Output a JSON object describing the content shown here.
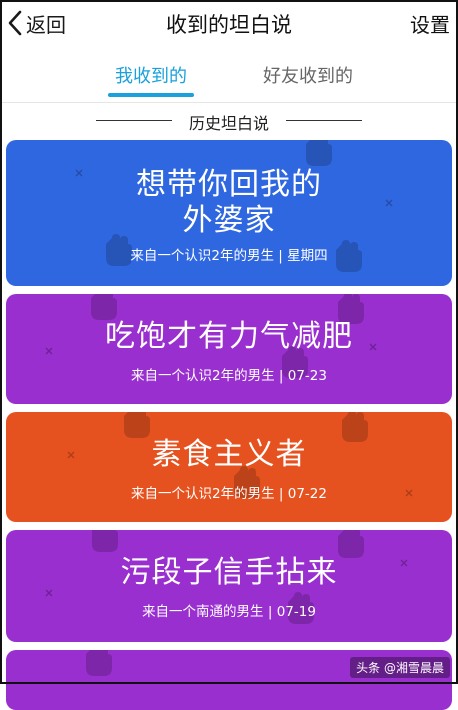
{
  "navbar": {
    "back_label": "返回",
    "title": "收到的坦白说",
    "settings_label": "设置"
  },
  "tabs": [
    {
      "label": "我收到的",
      "active": true
    },
    {
      "label": "好友收到的",
      "active": false
    }
  ],
  "section_title": "历史坦白说",
  "cards": [
    {
      "title_line1": "想带你回我的",
      "title_line2": "外婆家",
      "subtitle": "来自一个认识2年的男生 | 星期四",
      "color": "#2f67e0"
    },
    {
      "title_line1": "吃饱才有力气减肥",
      "subtitle": "来自一个认识2年的男生 | 07-23",
      "color": "#9a2fcf"
    },
    {
      "title_line1": "素食主义者",
      "subtitle": "来自一个认识2年的男生 | 07-22",
      "color": "#e6521f"
    },
    {
      "title_line1": "污段子信手拈来",
      "subtitle": "来自一个南通的男生 | 07-19",
      "color": "#9a2fcf"
    },
    {
      "title_line1": "",
      "subtitle": "",
      "color": "#9a2fcf"
    }
  ],
  "watermark": "头条 @湘雪晨晨",
  "colors": {
    "accent": "#1aa0dc",
    "inactive_tab": "#666666"
  }
}
